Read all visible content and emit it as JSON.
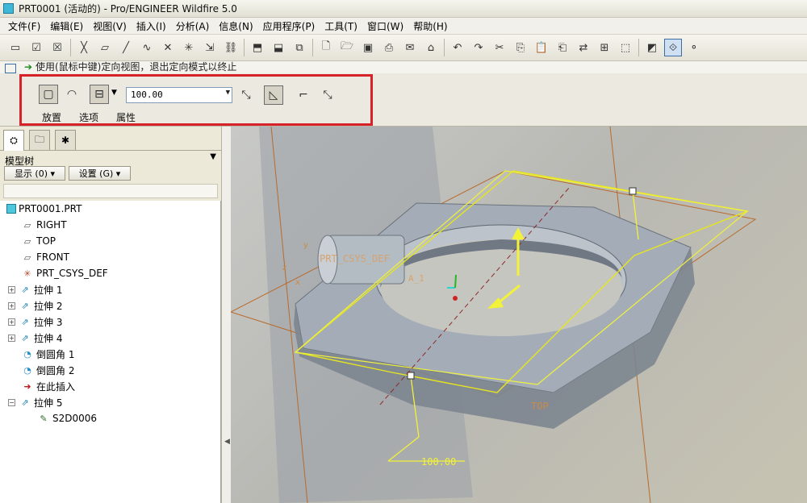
{
  "window": {
    "title": "PRT0001 (活动的) - Pro/ENGINEER Wildfire 5.0"
  },
  "menu": [
    "文件(F)",
    "编辑(E)",
    "视图(V)",
    "插入(I)",
    "分析(A)",
    "信息(N)",
    "应用程序(P)",
    "工具(T)",
    "窗口(W)",
    "帮助(H)"
  ],
  "message": {
    "text": "使用(鼠标中键)定向视图，退出定向模式以终止"
  },
  "dashboard": {
    "depth_value": "100.00",
    "tabs": [
      "放置",
      "选项",
      "属性"
    ]
  },
  "navigator": {
    "tree_title": "模型树",
    "show_button": "显示 (0) ▾",
    "settings_button": "设置 (G) ▾",
    "tree": [
      {
        "label": "PRT0001.PRT",
        "icon": "part-icon",
        "expandable": false
      },
      {
        "label": "RIGHT",
        "icon": "datum-plane-icon",
        "expandable": false
      },
      {
        "label": "TOP",
        "icon": "datum-plane-icon",
        "expandable": false
      },
      {
        "label": "FRONT",
        "icon": "datum-plane-icon",
        "expandable": false
      },
      {
        "label": "PRT_CSYS_DEF",
        "icon": "csys-icon",
        "expandable": false
      },
      {
        "label": "拉伸 1",
        "icon": "extrude-icon",
        "expandable": true
      },
      {
        "label": "拉伸 2",
        "icon": "extrude-icon",
        "expandable": true
      },
      {
        "label": "拉伸 3",
        "icon": "extrude-icon",
        "expandable": true
      },
      {
        "label": "拉伸 4",
        "icon": "extrude-icon",
        "expandable": true
      },
      {
        "label": "倒圆角 1",
        "icon": "round-icon",
        "expandable": false
      },
      {
        "label": "倒圆角 2",
        "icon": "round-icon",
        "expandable": false
      },
      {
        "label": "在此插入",
        "icon": "insert-here-icon",
        "expandable": false
      },
      {
        "label": "拉伸 5",
        "icon": "extrude-icon",
        "expandable": true
      },
      {
        "label": "S2D0006",
        "icon": "sketch-icon",
        "expandable": false
      }
    ]
  },
  "viewport": {
    "labels": {
      "csys": "PRT_CSYS_DEF",
      "axis": "A_1",
      "plane_top": "TOP",
      "dimension": "100.00",
      "axis_x": "x",
      "axis_y": "y",
      "axis_z": "z"
    },
    "colors": {
      "model": "#9aa3ad",
      "sketch": "#f2f23a",
      "datum": "#b86a2c",
      "highlight_box": "#d8222a"
    }
  }
}
